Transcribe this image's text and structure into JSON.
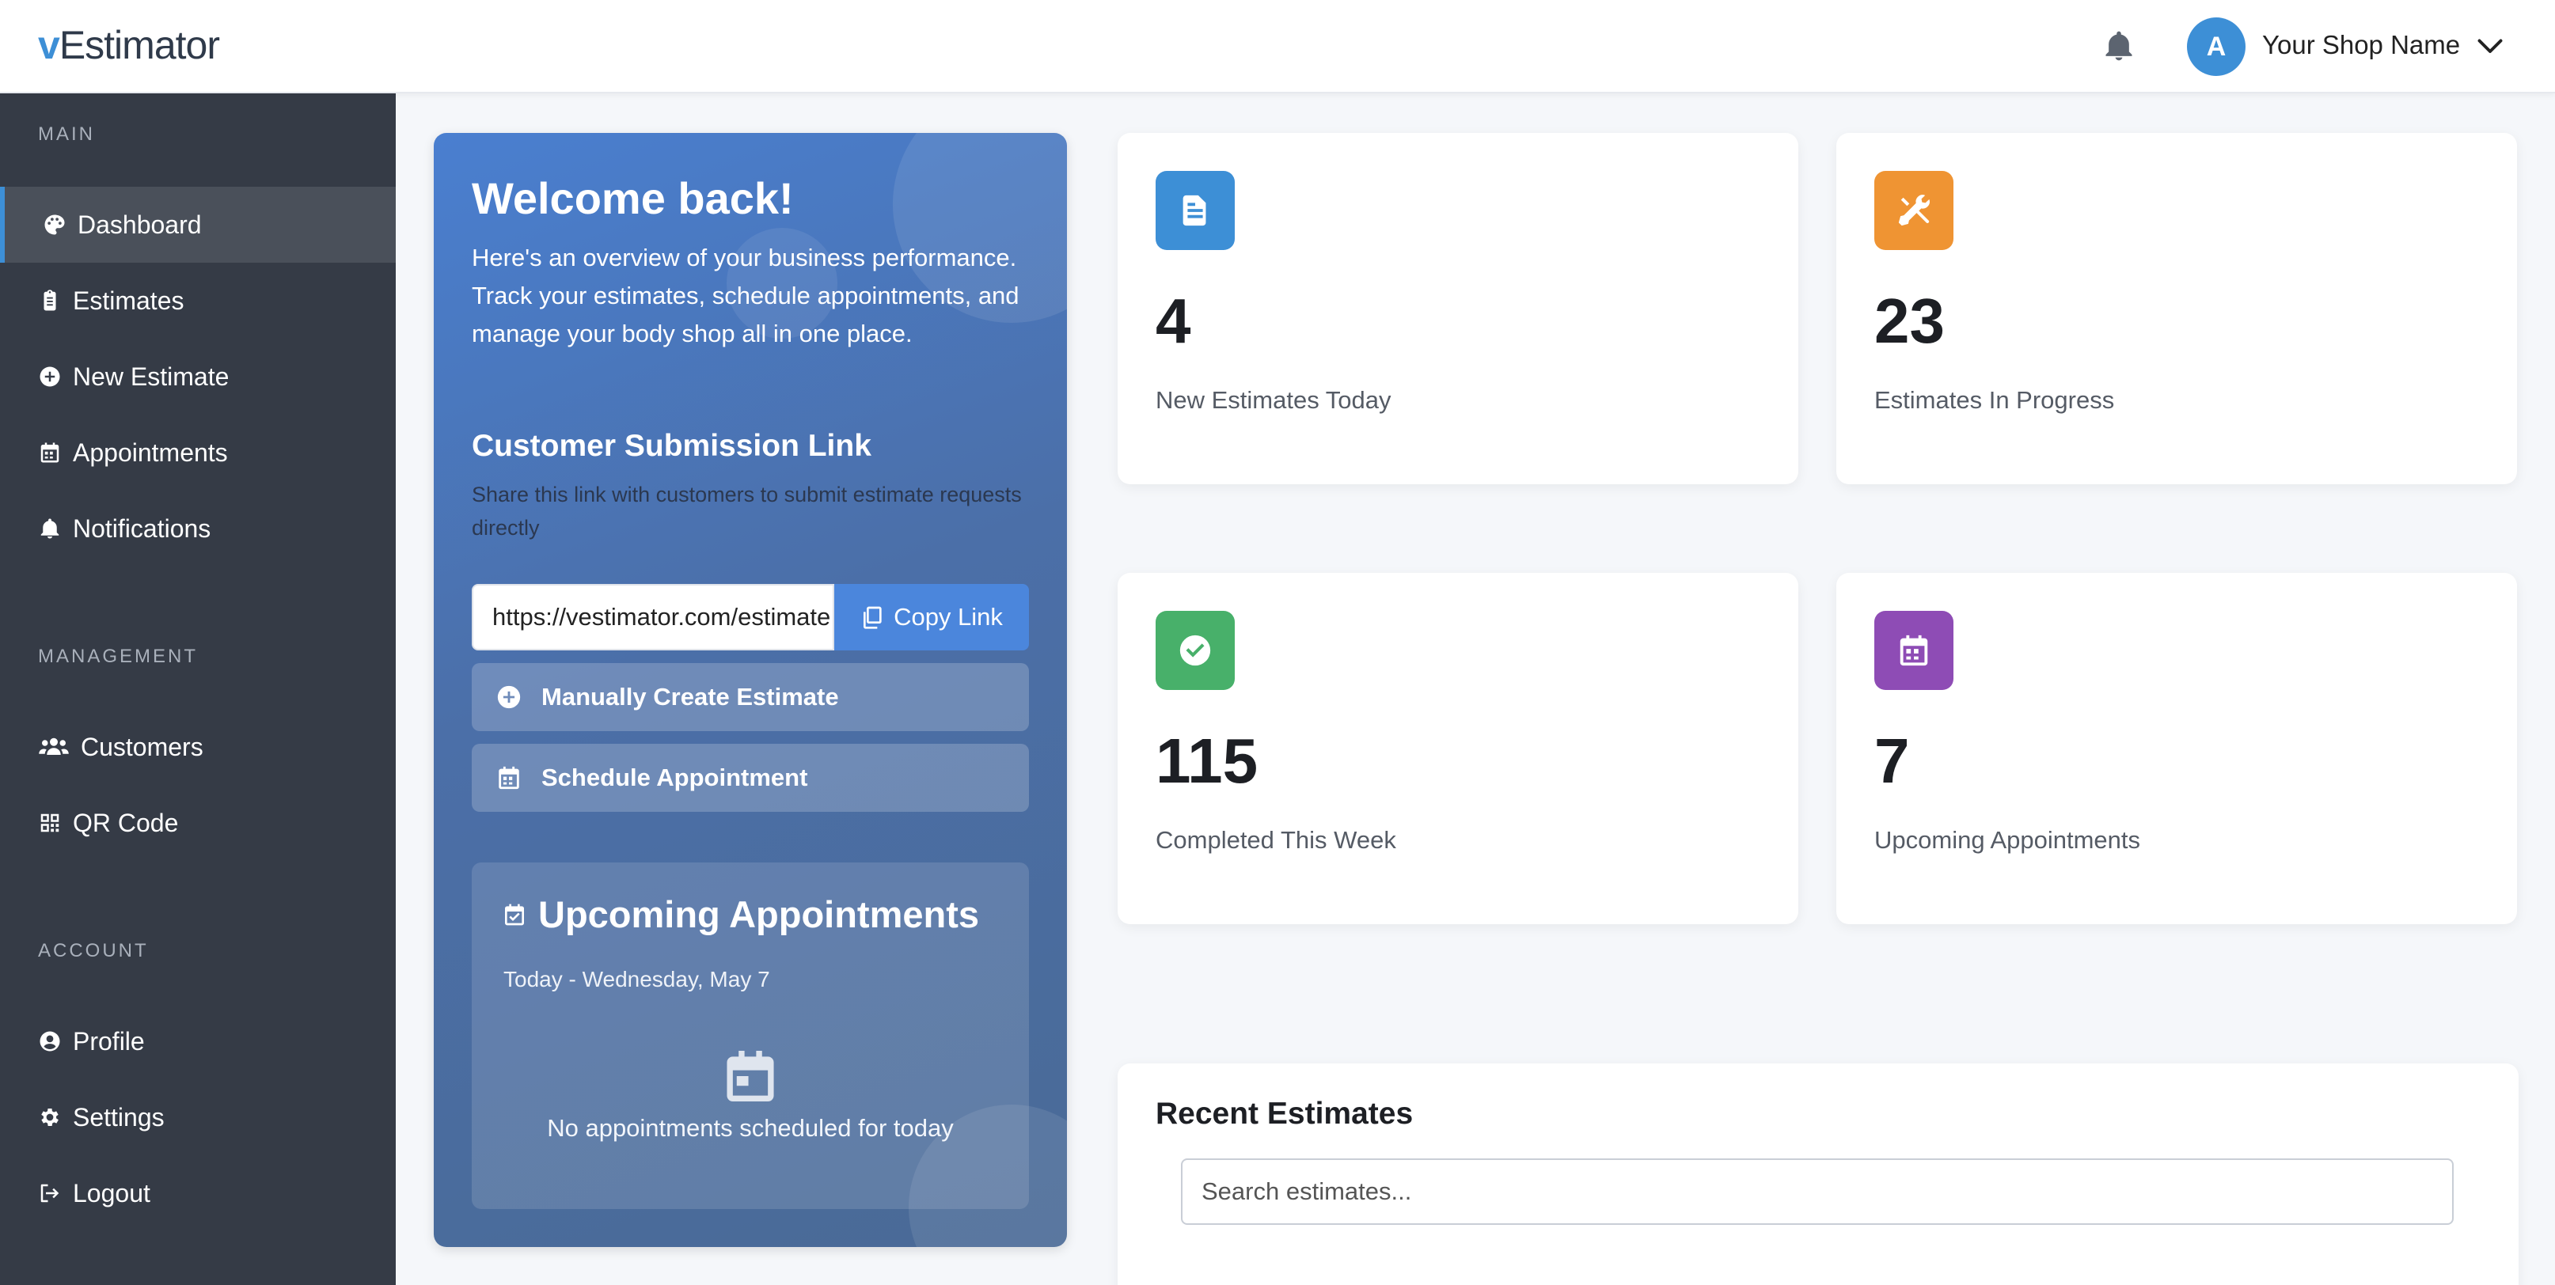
{
  "header": {
    "logo_v": "v",
    "logo_rest": "Estimator",
    "avatar_initial": "A",
    "shop_name": "Your Shop Name"
  },
  "sidebar": {
    "sections": [
      {
        "label": "MAIN"
      },
      {
        "label": "MANAGEMENT"
      },
      {
        "label": "ACCOUNT"
      }
    ],
    "items": [
      {
        "label": "Dashboard",
        "icon": "palette-icon",
        "active": true
      },
      {
        "label": "Estimates",
        "icon": "clipboard-icon"
      },
      {
        "label": "New Estimate",
        "icon": "plus-circle-icon"
      },
      {
        "label": "Appointments",
        "icon": "calendar-icon"
      },
      {
        "label": "Notifications",
        "icon": "bell-icon"
      },
      {
        "label": "Customers",
        "icon": "users-icon"
      },
      {
        "label": "QR Code",
        "icon": "qr-code-icon"
      },
      {
        "label": "Profile",
        "icon": "user-circle-icon"
      },
      {
        "label": "Settings",
        "icon": "gear-icon"
      },
      {
        "label": "Logout",
        "icon": "logout-icon"
      }
    ]
  },
  "welcome": {
    "title": "Welcome back!",
    "text": "Here's an overview of your business performance. Track your estimates, schedule appointments, and manage your body shop all in one place.",
    "link_title": "Customer Submission Link",
    "link_text": "Share this link with customers to submit estimate requests directly",
    "link_value": "https://vestimator.com/estimate",
    "copy_label": "Copy Link",
    "manual_label": "Manually Create Estimate",
    "schedule_label": "Schedule Appointment",
    "appointments": {
      "title": "Upcoming Appointments",
      "date": "Today - Wednesday, May 7",
      "empty": "No appointments scheduled for today"
    }
  },
  "stats": [
    {
      "value": "4",
      "label": "New Estimates Today",
      "color": "#3d8fd6",
      "icon": "document-icon"
    },
    {
      "value": "23",
      "label": "Estimates In Progress",
      "color": "#ef9433",
      "icon": "tools-icon"
    },
    {
      "value": "115",
      "label": "Completed This Week",
      "color": "#48b06a",
      "icon": "check-circle-icon"
    },
    {
      "value": "7",
      "label": "Upcoming Appointments",
      "color": "#8e4cb5",
      "icon": "calendar-icon"
    }
  ],
  "recent": {
    "title": "Recent Estimates",
    "search_placeholder": "Search estimates..."
  },
  "colors": {
    "accent": "#3d8fd6",
    "sidebar_bg": "#353b46"
  }
}
